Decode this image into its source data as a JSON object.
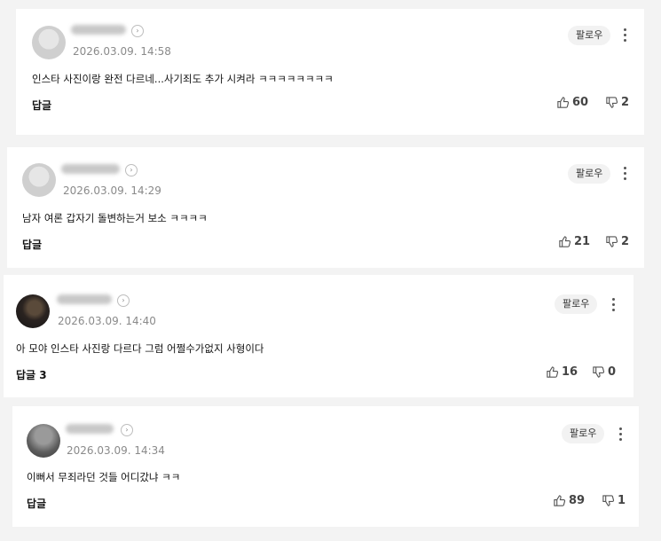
{
  "comments": [
    {
      "date": "2026.03.09. 14:58",
      "text": "인스타 사진이랑 완전 다르네...사기죄도 추가 시켜라 ㅋㅋㅋㅋㅋㅋㅋㅋ",
      "follow": "팔로우",
      "reply": "답글",
      "likes": "60",
      "dislikes": "2",
      "avatar": "default-avatar"
    },
    {
      "date": "2026.03.09. 14:29",
      "text": "남자 여론 갑자기 돌변하는거 보소 ㅋㅋㅋㅋ",
      "follow": "팔로우",
      "reply": "답글",
      "likes": "21",
      "dislikes": "2",
      "avatar": "default-avatar"
    },
    {
      "date": "2026.03.09. 14:40",
      "text": "아 모야 인스타 사진랑 다르다 그럼 어쩔수가없지 사형이다",
      "follow": "팔로우",
      "reply": "답글 3",
      "likes": "16",
      "dislikes": "0",
      "avatar": "photo-avatar"
    },
    {
      "date": "2026.03.09. 14:34",
      "text": "이뻐서 무죄라던 것들 어디갔냐 ㅋㅋ",
      "follow": "팔로우",
      "reply": "답글",
      "likes": "89",
      "dislikes": "1",
      "avatar": "photo-avatar"
    }
  ],
  "icons": {
    "like": "thumbs-up-icon",
    "dislike": "thumbs-down-icon",
    "more": "more-vertical-icon",
    "profile_link": "chevron-right-icon"
  }
}
